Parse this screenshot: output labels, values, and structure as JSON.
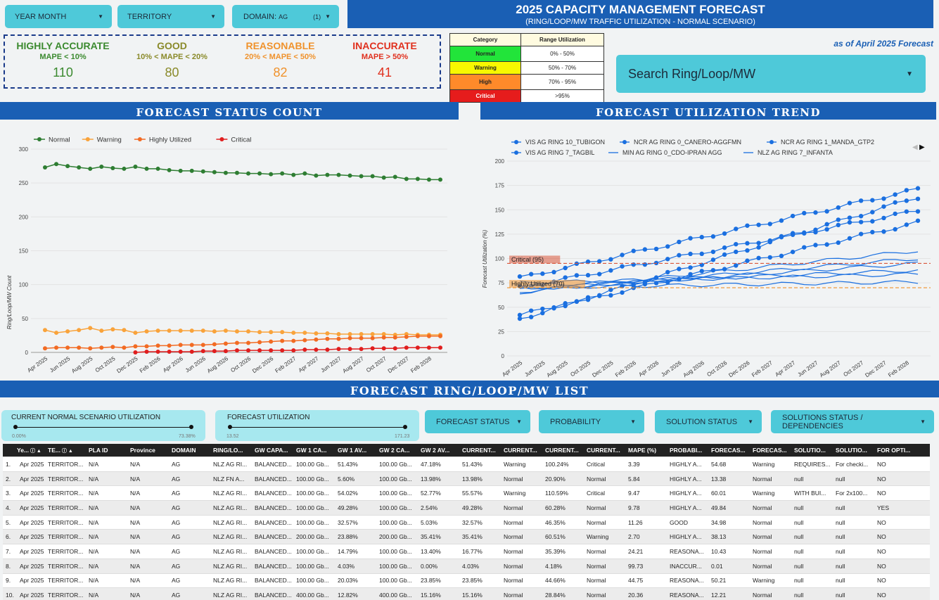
{
  "filters": {
    "year_month": "YEAR MONTH",
    "territory": "TERRITORY",
    "domain_label": "DOMAIN:",
    "domain_value": "AG",
    "domain_count": "(1)"
  },
  "header": {
    "title": "2025 CAPACITY MANAGEMENT FORECAST",
    "subtitle": "(RING/LOOP/MW TRAFFIC UTILIZATION - NORMAL SCENARIO)",
    "as_of": "as of April 2025 Forecast"
  },
  "kpis": [
    {
      "title": "HIGHLY ACCURATE",
      "sub": "MAPE < 10%",
      "value": "110",
      "color": "#3b8a2f"
    },
    {
      "title": "GOOD",
      "sub": "10% < MAPE < 20%",
      "value": "80",
      "color": "#8a8a2a"
    },
    {
      "title": "REASONABLE",
      "sub": "20% < MAPE < 50%",
      "value": "82",
      "color": "#f0922c"
    },
    {
      "title": "INACCURATE",
      "sub": "MAPE > 50%",
      "value": "41",
      "color": "#e0301e"
    }
  ],
  "legend_table": {
    "headers": [
      "Category",
      "Range Utilization"
    ],
    "rows": [
      {
        "category": "Normal",
        "range": "0% - 50%",
        "color": "#22e43a"
      },
      {
        "category": "Warning",
        "range": "50% - 70%",
        "color": "#f8f800"
      },
      {
        "category": "High",
        "range": "70% - 95%",
        "color": "#ff8a2a"
      },
      {
        "category": "Critical",
        "range": ">95%",
        "color": "#e61c1c"
      }
    ]
  },
  "search": {
    "label": "Search Ring/Loop/MW"
  },
  "sections": {
    "status_count": "FORECAST STATUS COUNT",
    "util_trend": "FORECAST UTILIZATION TREND",
    "list": "FORECAST RING/LOOP/MW LIST"
  },
  "sliders": [
    {
      "label": "CURRENT NORMAL SCENARIO UTILIZATION",
      "min": "0.00%",
      "max": "73.38%"
    },
    {
      "label": "FORECAST UTILIZATION",
      "min": "13.52",
      "max": "171.23"
    }
  ],
  "list_filters": [
    "FORECAST STATUS",
    "PROBABILITY",
    "SOLUTION STATUS",
    "SOLUTIONS STATUS / DEPENDENCIES"
  ],
  "chart_data": [
    {
      "type": "line",
      "ylabel": "Ring/Loop/MW Count",
      "ylim": [
        0,
        300
      ],
      "yticks": [
        0,
        50,
        100,
        150,
        200,
        250,
        300
      ],
      "x": [
        "Apr 2025",
        "May 2025",
        "Jun 2025",
        "Jul 2025",
        "Aug 2025",
        "Sep 2025",
        "Oct 2025",
        "Nov 2025",
        "Dec 2025",
        "Jan 2026",
        "Feb 2026",
        "Mar 2026",
        "Apr 2026",
        "May 2026",
        "Jun 2026",
        "Jul 2026",
        "Aug 2026",
        "Sep 2026",
        "Oct 2026",
        "Nov 2026",
        "Dec 2026",
        "Jan 2027",
        "Feb 2027",
        "Mar 2027",
        "Apr 2027",
        "May 2027",
        "Jun 2027",
        "Jul 2027",
        "Aug 2027",
        "Sep 2027",
        "Oct 2027",
        "Nov 2027",
        "Dec 2027",
        "Jan 2028",
        "Feb 2028",
        "Mar 2028"
      ],
      "xtick_labels": [
        "Apr 2025",
        "Jun 2025",
        "Aug 2025",
        "Oct 2025",
        "Dec 2025",
        "Feb 2026",
        "Apr 2026",
        "Jun 2026",
        "Aug 2026",
        "Oct 2026",
        "Dec 2026",
        "Feb 2027",
        "Apr 2027",
        "Jun 2027",
        "Aug 2027",
        "Oct 2027",
        "Dec 2027",
        "Feb 2028"
      ],
      "legend_position": "top",
      "series": [
        {
          "name": "Normal",
          "color": "#2e7d32",
          "values": [
            273,
            278,
            275,
            273,
            271,
            274,
            272,
            271,
            274,
            271,
            271,
            269,
            268,
            268,
            267,
            266,
            265,
            265,
            264,
            264,
            263,
            264,
            262,
            264,
            261,
            262,
            262,
            261,
            260,
            260,
            258,
            259,
            256,
            256,
            255,
            255
          ]
        },
        {
          "name": "Warning",
          "color": "#f9a33b",
          "values": [
            33,
            29,
            31,
            33,
            36,
            32,
            34,
            33,
            29,
            31,
            32,
            32,
            32,
            32,
            32,
            31,
            32,
            31,
            31,
            30,
            30,
            30,
            29,
            29,
            28,
            28,
            27,
            27,
            27,
            27,
            27,
            26,
            27,
            26,
            26,
            26
          ]
        },
        {
          "name": "Highly Utilized",
          "color": "#f26b23",
          "values": [
            6,
            7,
            7,
            7,
            6,
            7,
            8,
            7,
            9,
            9,
            10,
            10,
            11,
            11,
            11,
            12,
            13,
            14,
            14,
            15,
            16,
            17,
            17,
            18,
            19,
            20,
            20,
            21,
            21,
            21,
            22,
            22,
            23,
            24,
            24,
            24
          ]
        },
        {
          "name": "Critical",
          "color": "#e01e1e",
          "values": [
            null,
            null,
            null,
            null,
            null,
            null,
            null,
            null,
            0,
            1,
            1,
            1,
            1,
            1,
            2,
            2,
            2,
            3,
            3,
            3,
            3,
            3,
            3,
            4,
            4,
            4,
            5,
            5,
            5,
            6,
            6,
            6,
            7,
            7,
            7,
            7
          ]
        }
      ]
    },
    {
      "type": "line",
      "ylabel": "Forecast Utilization (%)",
      "ylim": [
        0,
        200
      ],
      "yticks": [
        0,
        25,
        50,
        75,
        100,
        125,
        150,
        175,
        200
      ],
      "x_count": 36,
      "xtick_labels": [
        "Apr 2025",
        "Jun 2025",
        "Aug 2025",
        "Oct 2025",
        "Dec 2025",
        "Feb 2026",
        "Apr 2026",
        "Jun 2026",
        "Aug 2026",
        "Oct 2026",
        "Dec 2026",
        "Feb 2027",
        "Apr 2027",
        "Jun 2027",
        "Aug 2027",
        "Oct 2027",
        "Dec 2027",
        "Feb 2028"
      ],
      "thresholds": [
        {
          "label": "Critical (95)",
          "value": 95,
          "color": "#d9553a"
        },
        {
          "label": "Highly Utilized (70)",
          "value": 70,
          "color": "#f0922c"
        }
      ],
      "legend_position": "top",
      "series": [
        {
          "name": "VIS AG RING 10_TUBIGON",
          "marker": true,
          "start": 42,
          "end": 137
        },
        {
          "name": "NCR AG RING 0_CANERO-AGGFMN",
          "marker": true,
          "start": 80,
          "end": 171
        },
        {
          "name": "NCR AG RING 1_MANDA_GTP2",
          "marker": true,
          "start": 70,
          "end": 149
        },
        {
          "name": "VIS AG RING 7_TAGBIL",
          "marker": true,
          "start": 38,
          "end": 163
        },
        {
          "name": "MIN AG RING 0_CDO-IPRAN AGG",
          "marker": false,
          "start": 65,
          "end": 108
        },
        {
          "name": "NLZ AG RING 7_INFANTA",
          "marker": false,
          "start": 72,
          "end": 88
        }
      ],
      "extra_lines": [
        {
          "start": 68,
          "end": 95
        },
        {
          "start": 75,
          "end": 84
        },
        {
          "start": 70,
          "end": 76
        },
        {
          "start": 66,
          "end": 100
        }
      ]
    }
  ],
  "table": {
    "headers": [
      "Ye...",
      "TE...",
      "PLA ID",
      "Province",
      "DOMAIN",
      "RING/LO...",
      "GW CAPA...",
      "GW 1 CA...",
      "GW 1 AV...",
      "GW 2 CA...",
      "GW 2 AV...",
      "CURRENT...",
      "CURRENT...",
      "CURRENT...",
      "CURRENT...",
      "MAPE (%)",
      "PROBABI...",
      "FORECAS...",
      "FORECAS...",
      "SOLUTIO...",
      "SOLUTIO...",
      "FOR OPTI..."
    ],
    "rows": [
      [
        "1.",
        "Apr 2025",
        "TERRITOR...",
        "N/A",
        "N/A",
        "AG",
        "NLZ AG RI...",
        "BALANCED...",
        "100.00 Gb...",
        "51.43%",
        "100.00 Gb...",
        "47.18%",
        "51.43%",
        "Warning",
        "100.24%",
        "Critical",
        "3.39",
        "HIGHLY A...",
        "54.68",
        "Warning",
        "REQUIRES...",
        "For checki...",
        "NO"
      ],
      [
        "2.",
        "Apr 2025",
        "TERRITOR...",
        "N/A",
        "N/A",
        "AG",
        "NLZ FN A...",
        "BALANCED...",
        "100.00 Gb...",
        "5.60%",
        "100.00 Gb...",
        "13.98%",
        "13.98%",
        "Normal",
        "20.90%",
        "Normal",
        "5.84",
        "HIGHLY A...",
        "13.38",
        "Normal",
        "null",
        "null",
        "NO"
      ],
      [
        "3.",
        "Apr 2025",
        "TERRITOR...",
        "N/A",
        "N/A",
        "AG",
        "NLZ AG RI...",
        "BALANCED...",
        "100.00 Gb...",
        "54.02%",
        "100.00 Gb...",
        "52.77%",
        "55.57%",
        "Warning",
        "110.59%",
        "Critical",
        "9.47",
        "HIGHLY A...",
        "60.01",
        "Warning",
        "WITH BUI...",
        "For 2x100...",
        "NO"
      ],
      [
        "4.",
        "Apr 2025",
        "TERRITOR...",
        "N/A",
        "N/A",
        "AG",
        "NLZ AG RI...",
        "BALANCED...",
        "100.00 Gb...",
        "49.28%",
        "100.00 Gb...",
        "2.54%",
        "49.28%",
        "Normal",
        "60.28%",
        "Normal",
        "9.78",
        "HIGHLY A...",
        "49.84",
        "Normal",
        "null",
        "null",
        "YES"
      ],
      [
        "5.",
        "Apr 2025",
        "TERRITOR...",
        "N/A",
        "N/A",
        "AG",
        "NLZ AG RI...",
        "BALANCED...",
        "100.00 Gb...",
        "32.57%",
        "100.00 Gb...",
        "5.03%",
        "32.57%",
        "Normal",
        "46.35%",
        "Normal",
        "11.26",
        "GOOD",
        "34.98",
        "Normal",
        "null",
        "null",
        "NO"
      ],
      [
        "6.",
        "Apr 2025",
        "TERRITOR...",
        "N/A",
        "N/A",
        "AG",
        "NLZ AG RI...",
        "BALANCED...",
        "200.00 Gb...",
        "23.88%",
        "200.00 Gb...",
        "35.41%",
        "35.41%",
        "Normal",
        "60.51%",
        "Warning",
        "2.70",
        "HIGHLY A...",
        "38.13",
        "Normal",
        "null",
        "null",
        "NO"
      ],
      [
        "7.",
        "Apr 2025",
        "TERRITOR...",
        "N/A",
        "N/A",
        "AG",
        "NLZ AG RI...",
        "BALANCED...",
        "100.00 Gb...",
        "14.79%",
        "100.00 Gb...",
        "13.40%",
        "16.77%",
        "Normal",
        "35.39%",
        "Normal",
        "24.21",
        "REASONA...",
        "10.43",
        "Normal",
        "null",
        "null",
        "NO"
      ],
      [
        "8.",
        "Apr 2025",
        "TERRITOR...",
        "N/A",
        "N/A",
        "AG",
        "NLZ AG RI...",
        "BALANCED...",
        "100.00 Gb...",
        "4.03%",
        "100.00 Gb...",
        "0.00%",
        "4.03%",
        "Normal",
        "4.18%",
        "Normal",
        "99.73",
        "INACCUR...",
        "0.01",
        "Normal",
        "null",
        "null",
        "NO"
      ],
      [
        "9.",
        "Apr 2025",
        "TERRITOR...",
        "N/A",
        "N/A",
        "AG",
        "NLZ AG RI...",
        "BALANCED...",
        "100.00 Gb...",
        "20.03%",
        "100.00 Gb...",
        "23.85%",
        "23.85%",
        "Normal",
        "44.66%",
        "Normal",
        "44.75",
        "REASONA...",
        "50.21",
        "Warning",
        "null",
        "null",
        "NO"
      ],
      [
        "10.",
        "Apr 2025",
        "TERRITOR...",
        "N/A",
        "N/A",
        "AG",
        "NLZ AG RI...",
        "BALANCED...",
        "400.00 Gb...",
        "12.82%",
        "400.00 Gb...",
        "15.16%",
        "15.16%",
        "Normal",
        "28.84%",
        "Normal",
        "20.36",
        "REASONA...",
        "12.21",
        "Normal",
        "null",
        "null",
        "NO"
      ]
    ]
  }
}
